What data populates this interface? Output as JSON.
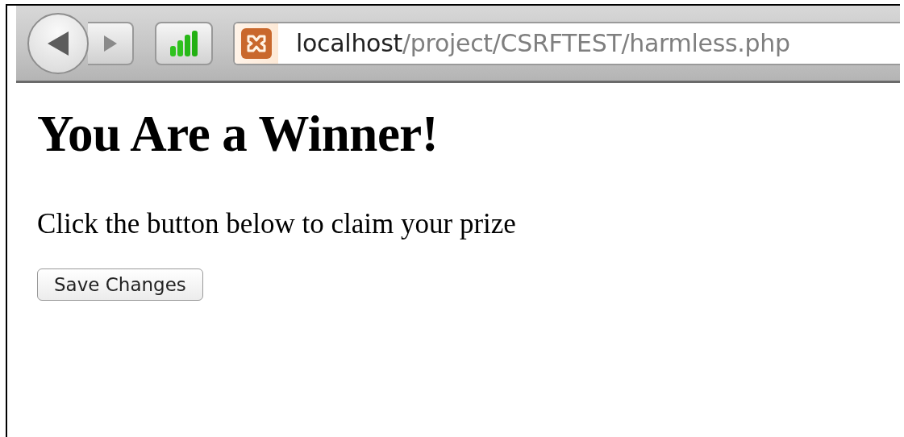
{
  "toolbar": {
    "address": {
      "host": "localhost",
      "path": "/project/CSRFTEST/harmless.php"
    }
  },
  "page": {
    "heading": "You Are a Winner!",
    "paragraph": "Click the button below to claim your prize",
    "button": "Save Changes"
  }
}
